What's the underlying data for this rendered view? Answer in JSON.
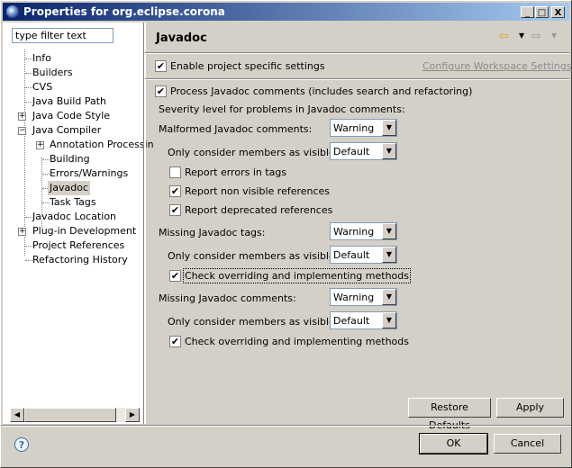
{
  "window": {
    "title": "Properties for org.eclipse.corona",
    "controls": {
      "minimize": "_",
      "maximize": "□",
      "close": "X"
    }
  },
  "filter": {
    "placeholder": "type filter text"
  },
  "tree": [
    {
      "label": "Info",
      "level": 1,
      "expandable": false
    },
    {
      "label": "Builders",
      "level": 1,
      "expandable": false
    },
    {
      "label": "CVS",
      "level": 1,
      "expandable": false
    },
    {
      "label": "Java Build Path",
      "level": 1,
      "expandable": false
    },
    {
      "label": "Java Code Style",
      "level": 1,
      "expandable": true,
      "expanded": false
    },
    {
      "label": "Java Compiler",
      "level": 1,
      "expandable": true,
      "expanded": true
    },
    {
      "label": "Annotation Processin",
      "level": 2,
      "expandable": true,
      "expanded": false
    },
    {
      "label": "Building",
      "level": 2,
      "expandable": false
    },
    {
      "label": "Errors/Warnings",
      "level": 2,
      "expandable": false
    },
    {
      "label": "Javadoc",
      "level": 2,
      "expandable": false,
      "selected": true
    },
    {
      "label": "Task Tags",
      "level": 2,
      "expandable": false
    },
    {
      "label": "Javadoc Location",
      "level": 1,
      "expandable": false
    },
    {
      "label": "Plug-in Development",
      "level": 1,
      "expandable": true,
      "expanded": false
    },
    {
      "label": "Project References",
      "level": 1,
      "expandable": false
    },
    {
      "label": "Refactoring History",
      "level": 1,
      "expandable": false
    }
  ],
  "page": {
    "title": "Javadoc",
    "enable_specific": {
      "label": "Enable project specific settings",
      "checked": true
    },
    "configure_link": "Configure Workspace Settings...",
    "process_javadoc": {
      "label": "Process Javadoc comments (includes search and refactoring)",
      "checked": true
    },
    "severity_heading": "Severity level for problems in Javadoc comments:",
    "malformed": {
      "label": "Malformed Javadoc comments:",
      "value": "Warning",
      "visibility_label": "Only consider members as visible as:",
      "visibility_value": "Default",
      "report_errors_in_tags": {
        "label": "Report errors in tags",
        "checked": false
      },
      "report_non_visible": {
        "label": "Report non visible references",
        "checked": true
      },
      "report_deprecated": {
        "label": "Report deprecated references",
        "checked": true
      }
    },
    "missing_tags": {
      "label": "Missing Javadoc tags:",
      "value": "Warning",
      "visibility_label": "Only consider members as visible as:",
      "visibility_value": "Default",
      "check_overriding": {
        "label": "Check overriding and implementing methods",
        "checked": true
      }
    },
    "missing_comments": {
      "label": "Missing Javadoc comments:",
      "value": "Warning",
      "visibility_label": "Only consider members as visible as:",
      "visibility_value": "Default",
      "check_overriding": {
        "label": "Check overriding and implementing methods",
        "checked": true
      }
    },
    "buttons": {
      "restore_defaults": "Restore Defaults",
      "apply": "Apply"
    }
  },
  "footer": {
    "ok": "OK",
    "cancel": "Cancel",
    "help_glyph": "?"
  },
  "check_glyph": "✔",
  "colors": {
    "title_start": "#0a246a",
    "title_end": "#a6caf0",
    "link": "#8a8a8a"
  }
}
